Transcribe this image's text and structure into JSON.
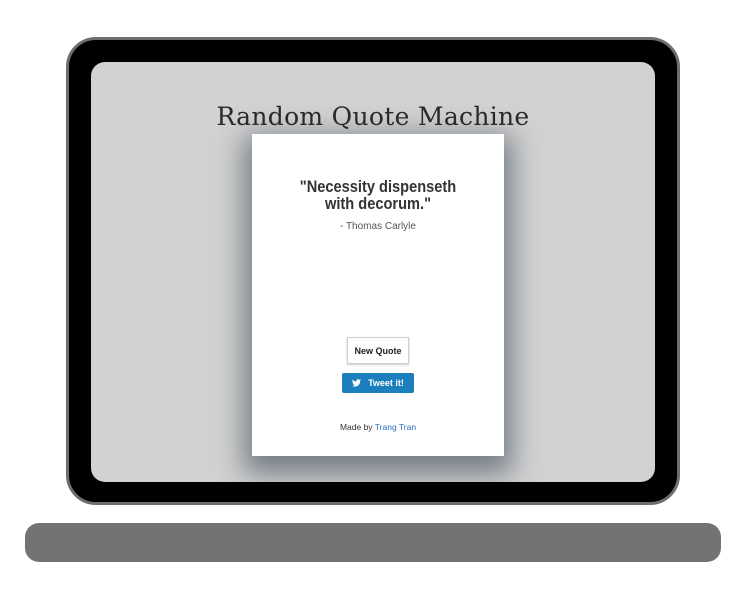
{
  "app": {
    "title": "Random Quote Machine"
  },
  "quote": {
    "text": "\"Necessity dispenseth with decorum.\"",
    "author": "- Thomas Carlyle"
  },
  "actions": {
    "new_quote_label": "New Quote",
    "tweet_label": "Tweet it!",
    "tweet_icon": "twitter-bird-icon"
  },
  "footer": {
    "made_by_prefix": "Made by",
    "author_link": "Trang Tran"
  },
  "colors": {
    "screen_background": "#d2d2d2",
    "bezel": "#000000",
    "base": "#737373",
    "tweet_button": "#1b7fbd",
    "link": "#2a6fb8"
  }
}
